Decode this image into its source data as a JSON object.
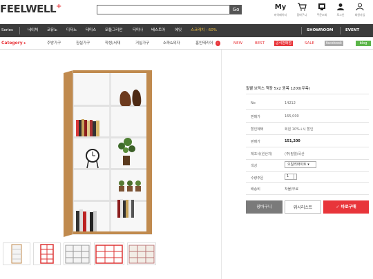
{
  "header": {
    "logo": "FEELWELL",
    "logo_plus": "+",
    "search_button": "Go",
    "utils": [
      {
        "icon": "my-page-icon",
        "glyph": "My",
        "label": "마이페이지"
      },
      {
        "icon": "cart-icon",
        "glyph": "🛒",
        "label": "장바구니"
      },
      {
        "icon": "order-icon",
        "glyph": "▣",
        "label": "주문조회"
      },
      {
        "icon": "login-icon",
        "glyph": "👤",
        "label": "로그인"
      },
      {
        "icon": "user-icon",
        "glyph": "☺",
        "label": "회원가입"
      }
    ]
  },
  "nav": {
    "series": "Series",
    "items": [
      "네이처",
      "코뮤노",
      "디자노",
      "테미스",
      "모듈그리안",
      "티미나",
      "베스트아",
      "에잇",
      "스크래치 - 60%"
    ],
    "showroom": "SHOWROOM",
    "event": "EVENT"
  },
  "category": {
    "label": "Category ▸",
    "items": [
      "주방가구",
      "침실가구",
      "학생/서재",
      "거실가구",
      "소파&의자",
      "홈인테리어"
    ],
    "new": "NEW",
    "best": "BEST",
    "outlet": "공식판매점",
    "sale": "SALE",
    "facebook": "facebook",
    "blog": "blog"
  },
  "product": {
    "title": "필웰 브릭스 책장 5x2 원목 1200(우측)",
    "rows": [
      {
        "label": "No",
        "value": "14212"
      },
      {
        "label": "판매가",
        "value": "165,000"
      },
      {
        "label": "할인혜택",
        "value": "회원 10%↓시 할인"
      },
      {
        "label": "판매가",
        "value": "151,200"
      },
      {
        "label": "제조사(원산지)",
        "value": "(주)필웰/국산"
      },
      {
        "label": "색상",
        "value": "오일리화이트 ▾"
      },
      {
        "label": "수량주문",
        "value": "1"
      },
      {
        "label": "배송비",
        "value": "착불/무료"
      }
    ],
    "buttons": {
      "cart": "장바구니",
      "wishlist": "위시리스트",
      "buy": "✓ 바로구매"
    }
  },
  "colors": {
    "accent": "#e8353a",
    "nav": "#3b3b3b",
    "buy": "#e8353a",
    "cart": "#7a7a7a"
  }
}
